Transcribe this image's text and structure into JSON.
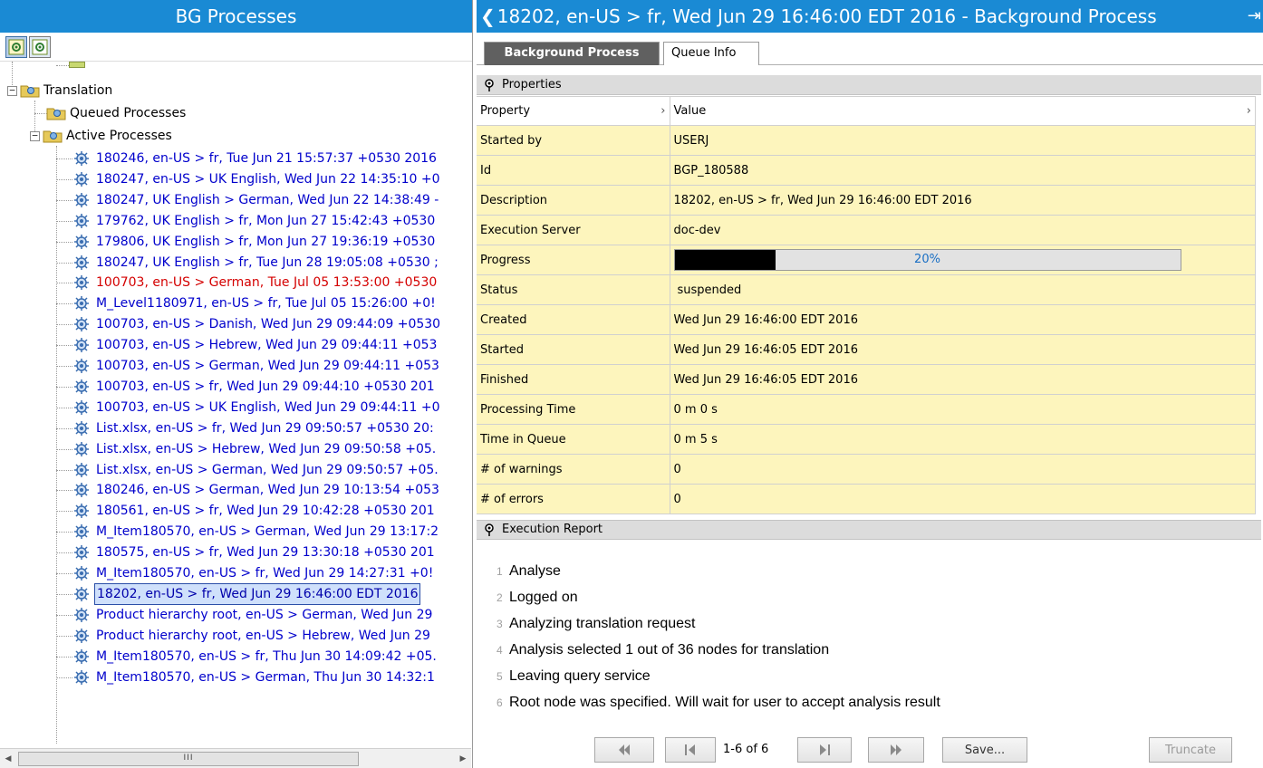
{
  "left_panel": {
    "title": "BG Processes",
    "toolbar": [
      {
        "icon": "bg-process-view-icon",
        "pressed": true
      },
      {
        "icon": "bg-process-alt-view-icon",
        "pressed": false
      }
    ],
    "tree": {
      "root": {
        "label": "Translation"
      },
      "groups": [
        {
          "label": "Queued Processes"
        },
        {
          "label": "Active Processes"
        }
      ],
      "processes": [
        {
          "label": "180246, en-US > fr, Tue Jun 21 15:57:37 +0530 2016",
          "state": "normal"
        },
        {
          "label": "180247, en-US > UK English, Wed Jun 22 14:35:10 +0",
          "state": "normal"
        },
        {
          "label": "180247, UK English > German, Wed Jun 22 14:38:49 -",
          "state": "normal"
        },
        {
          "label": "179762, UK English > fr, Mon Jun 27 15:42:43 +0530",
          "state": "normal"
        },
        {
          "label": "179806, UK English > fr, Mon Jun 27 19:36:19 +0530",
          "state": "normal"
        },
        {
          "label": "180247, UK English > fr, Tue Jun 28 19:05:08 +0530 ;",
          "state": "normal"
        },
        {
          "label": "100703, en-US > German, Tue Jul 05 13:53:00 +0530",
          "state": "error"
        },
        {
          "label": "M_Level1180971, en-US > fr, Tue Jul 05 15:26:00 +0!",
          "state": "normal"
        },
        {
          "label": "100703, en-US > Danish, Wed Jun 29 09:44:09 +0530",
          "state": "normal"
        },
        {
          "label": "100703, en-US > Hebrew, Wed Jun 29 09:44:11 +053",
          "state": "normal"
        },
        {
          "label": "100703, en-US > German, Wed Jun 29 09:44:11 +053",
          "state": "normal"
        },
        {
          "label": "100703, en-US > fr, Wed Jun 29 09:44:10 +0530 201",
          "state": "normal"
        },
        {
          "label": "100703, en-US > UK English, Wed Jun 29 09:44:11 +0",
          "state": "normal"
        },
        {
          "label": "List.xlsx, en-US > fr, Wed Jun 29 09:50:57 +0530 20:",
          "state": "normal"
        },
        {
          "label": "List.xlsx, en-US > Hebrew, Wed Jun 29 09:50:58 +05.",
          "state": "normal"
        },
        {
          "label": "List.xlsx, en-US > German, Wed Jun 29 09:50:57 +05.",
          "state": "normal"
        },
        {
          "label": "180246, en-US > German, Wed Jun 29 10:13:54 +053",
          "state": "normal"
        },
        {
          "label": "180561, en-US > fr, Wed Jun 29 10:42:28 +0530 201",
          "state": "normal"
        },
        {
          "label": "M_Item180570, en-US > German, Wed Jun 29 13:17:2",
          "state": "normal"
        },
        {
          "label": "180575, en-US > fr, Wed Jun 29 13:30:18 +0530 201",
          "state": "normal"
        },
        {
          "label": "M_Item180570, en-US > fr, Wed Jun 29 14:27:31 +0!",
          "state": "normal"
        },
        {
          "label": "18202, en-US > fr, Wed Jun 29 16:46:00 EDT 2016",
          "state": "selected"
        },
        {
          "label": "Product hierarchy root, en-US > German, Wed Jun 29",
          "state": "normal"
        },
        {
          "label": "Product hierarchy root, en-US > Hebrew, Wed Jun 29",
          "state": "normal"
        },
        {
          "label": "M_Item180570, en-US > fr, Thu Jun 30 14:09:42 +05.",
          "state": "normal"
        },
        {
          "label": "M_Item180570, en-US > German, Thu Jun 30 14:32:1",
          "state": "normal"
        }
      ]
    },
    "scrollbar": {
      "thumb_grip": "III"
    }
  },
  "right_panel": {
    "title": "18202, en-US > fr, Wed Jun 29 16:46:00 EDT 2016 - Background Process",
    "tabs": [
      {
        "label": "Background Process",
        "active": true
      },
      {
        "label": "Queue Info",
        "active": false
      }
    ],
    "properties": {
      "section_title": "Properties",
      "column_property": "Property",
      "column_value": "Value",
      "started_by": {
        "label": "Started by",
        "value": "USERJ"
      },
      "id": {
        "label": "Id",
        "value": "BGP_180588"
      },
      "description": {
        "label": "Description",
        "value": "18202, en-US > fr, Wed Jun 29 16:46:00 EDT 2016"
      },
      "execution_server": {
        "label": "Execution Server",
        "value": "doc-dev"
      },
      "progress": {
        "label": "Progress",
        "value_text": "20%",
        "percent": 20
      },
      "status": {
        "label": "Status",
        "value": "suspended"
      },
      "created": {
        "label": "Created",
        "value": "Wed Jun 29 16:46:00 EDT 2016"
      },
      "started": {
        "label": "Started",
        "value": "Wed Jun 29 16:46:05 EDT 2016"
      },
      "finished": {
        "label": "Finished",
        "value": "Wed Jun 29 16:46:05 EDT 2016"
      },
      "processing_time": {
        "label": "Processing Time",
        "value": "0 m 0 s"
      },
      "time_in_queue": {
        "label": "Time in Queue",
        "value": "0 m 5 s"
      },
      "warnings": {
        "label": "# of warnings",
        "value": "0"
      },
      "errors": {
        "label": "# of errors",
        "value": "0"
      }
    },
    "report": {
      "section_title": "Execution Report",
      "lines": [
        {
          "num": "1",
          "text": "Analyse"
        },
        {
          "num": "2",
          "text": "Logged on"
        },
        {
          "num": "3",
          "text": "Analyzing translation request"
        },
        {
          "num": "4",
          "text": "Analysis selected 1 out of 36 nodes for translation"
        },
        {
          "num": "5",
          "text": "Leaving query service"
        },
        {
          "num": "6",
          "text": "Root node was specified. Will wait for user to accept analysis result"
        }
      ],
      "page_info": "1-6 of 6",
      "save_label": "Save...",
      "truncate_label": "Truncate"
    }
  },
  "colors": {
    "header_blue": "#1a8ad4",
    "row_yellow": "#fdf5bd",
    "link_blue": "#0000cc",
    "error_red": "#d40000"
  }
}
